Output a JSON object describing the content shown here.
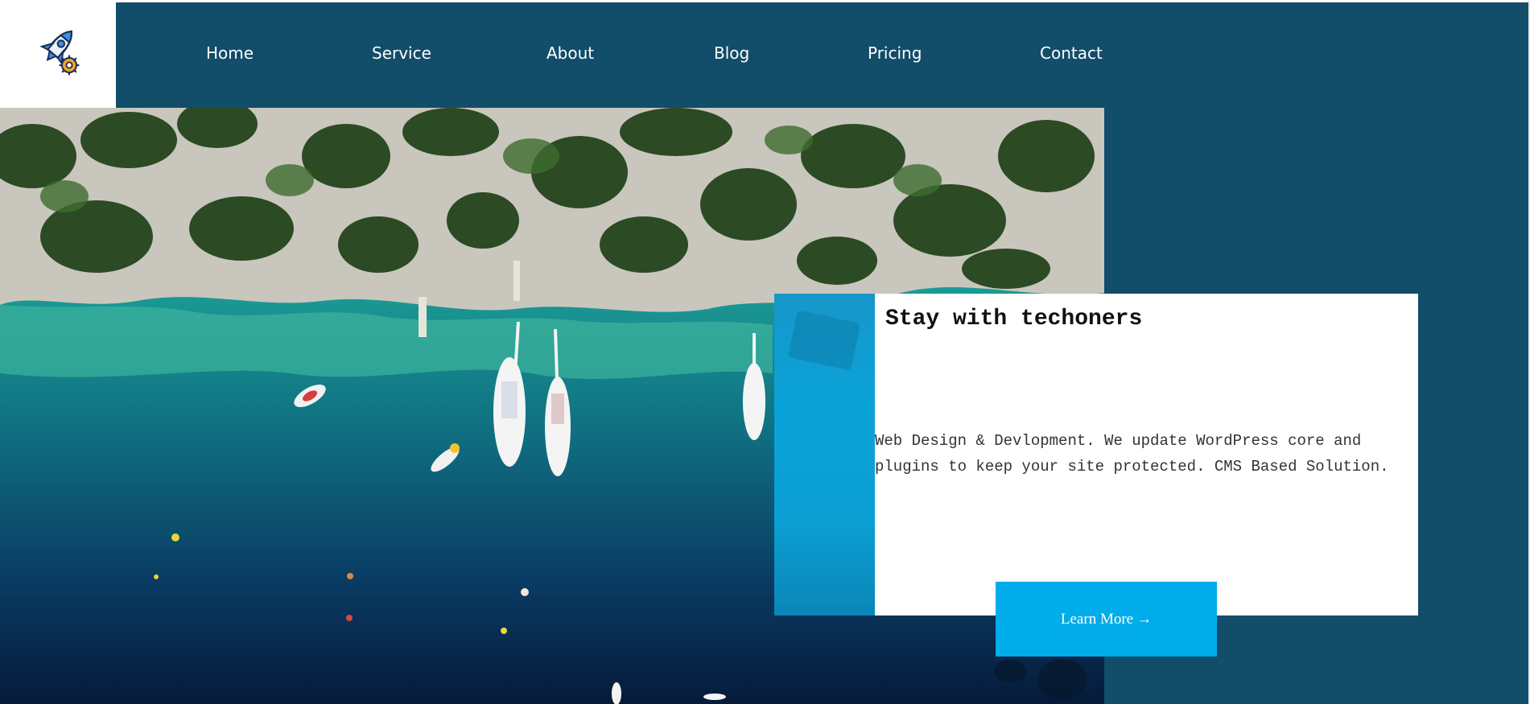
{
  "brand": {
    "logo_icon": "rocket-gear-icon"
  },
  "nav": {
    "items": [
      {
        "label": "Home"
      },
      {
        "label": "Service"
      },
      {
        "label": "About"
      },
      {
        "label": "Blog"
      },
      {
        "label": "Pricing"
      },
      {
        "label": "Contact"
      }
    ]
  },
  "hero": {
    "image_icon": "aerial-coast-boats-image"
  },
  "card": {
    "title": "Stay with techoners",
    "text": "Web Design & Devlopment. We update WordPress core and plugins to keep your site protected. CMS Based Solution.",
    "cta_label": "Learn More",
    "cta_icon": "arrow-right-icon",
    "cta_arrow": "→"
  },
  "colors": {
    "header": "#124d6a",
    "cta": "#00ace9",
    "accent": "#0aa3d9"
  }
}
